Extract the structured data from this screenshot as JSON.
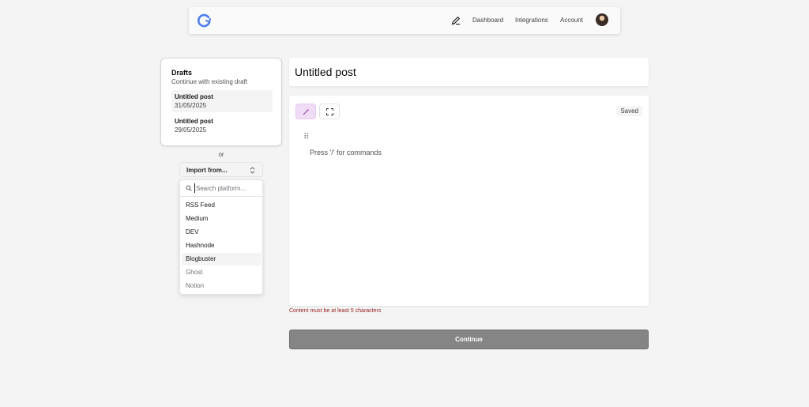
{
  "header": {
    "nav": [
      "Dashboard",
      "Integrations",
      "Account"
    ]
  },
  "drafts": {
    "title": "Drafts",
    "subtitle": "Continue with existing draft",
    "items": [
      {
        "name": "Untitled post",
        "date": "31/05/2025"
      },
      {
        "name": "Untitled post",
        "date": "29/05/2025"
      }
    ]
  },
  "or_label": "or",
  "import": {
    "label": "Import from...",
    "search_placeholder": "Search platform...",
    "options": [
      "RSS Feed",
      "Medium",
      "DEV",
      "Hashnode",
      "Blogbuster",
      "Ghost",
      "Notion"
    ]
  },
  "editor": {
    "title": "Untitled post",
    "status": "Saved",
    "placeholder": "Press '/' for commands",
    "drag_handle": "⠿"
  },
  "error": "Content must be at least 5 characters",
  "continue_label": "Continue",
  "colors": {
    "accent": "#4f7ef0",
    "wand_bg": "#f1dcf6",
    "error": "#991b1b",
    "continue_bg": "#858585"
  },
  "icons": [
    "logo-icon",
    "pen-icon",
    "avatar",
    "chevron-updown-icon",
    "search-icon",
    "magic-wand-icon",
    "fullscreen-icon",
    "drag-handle-icon"
  ]
}
